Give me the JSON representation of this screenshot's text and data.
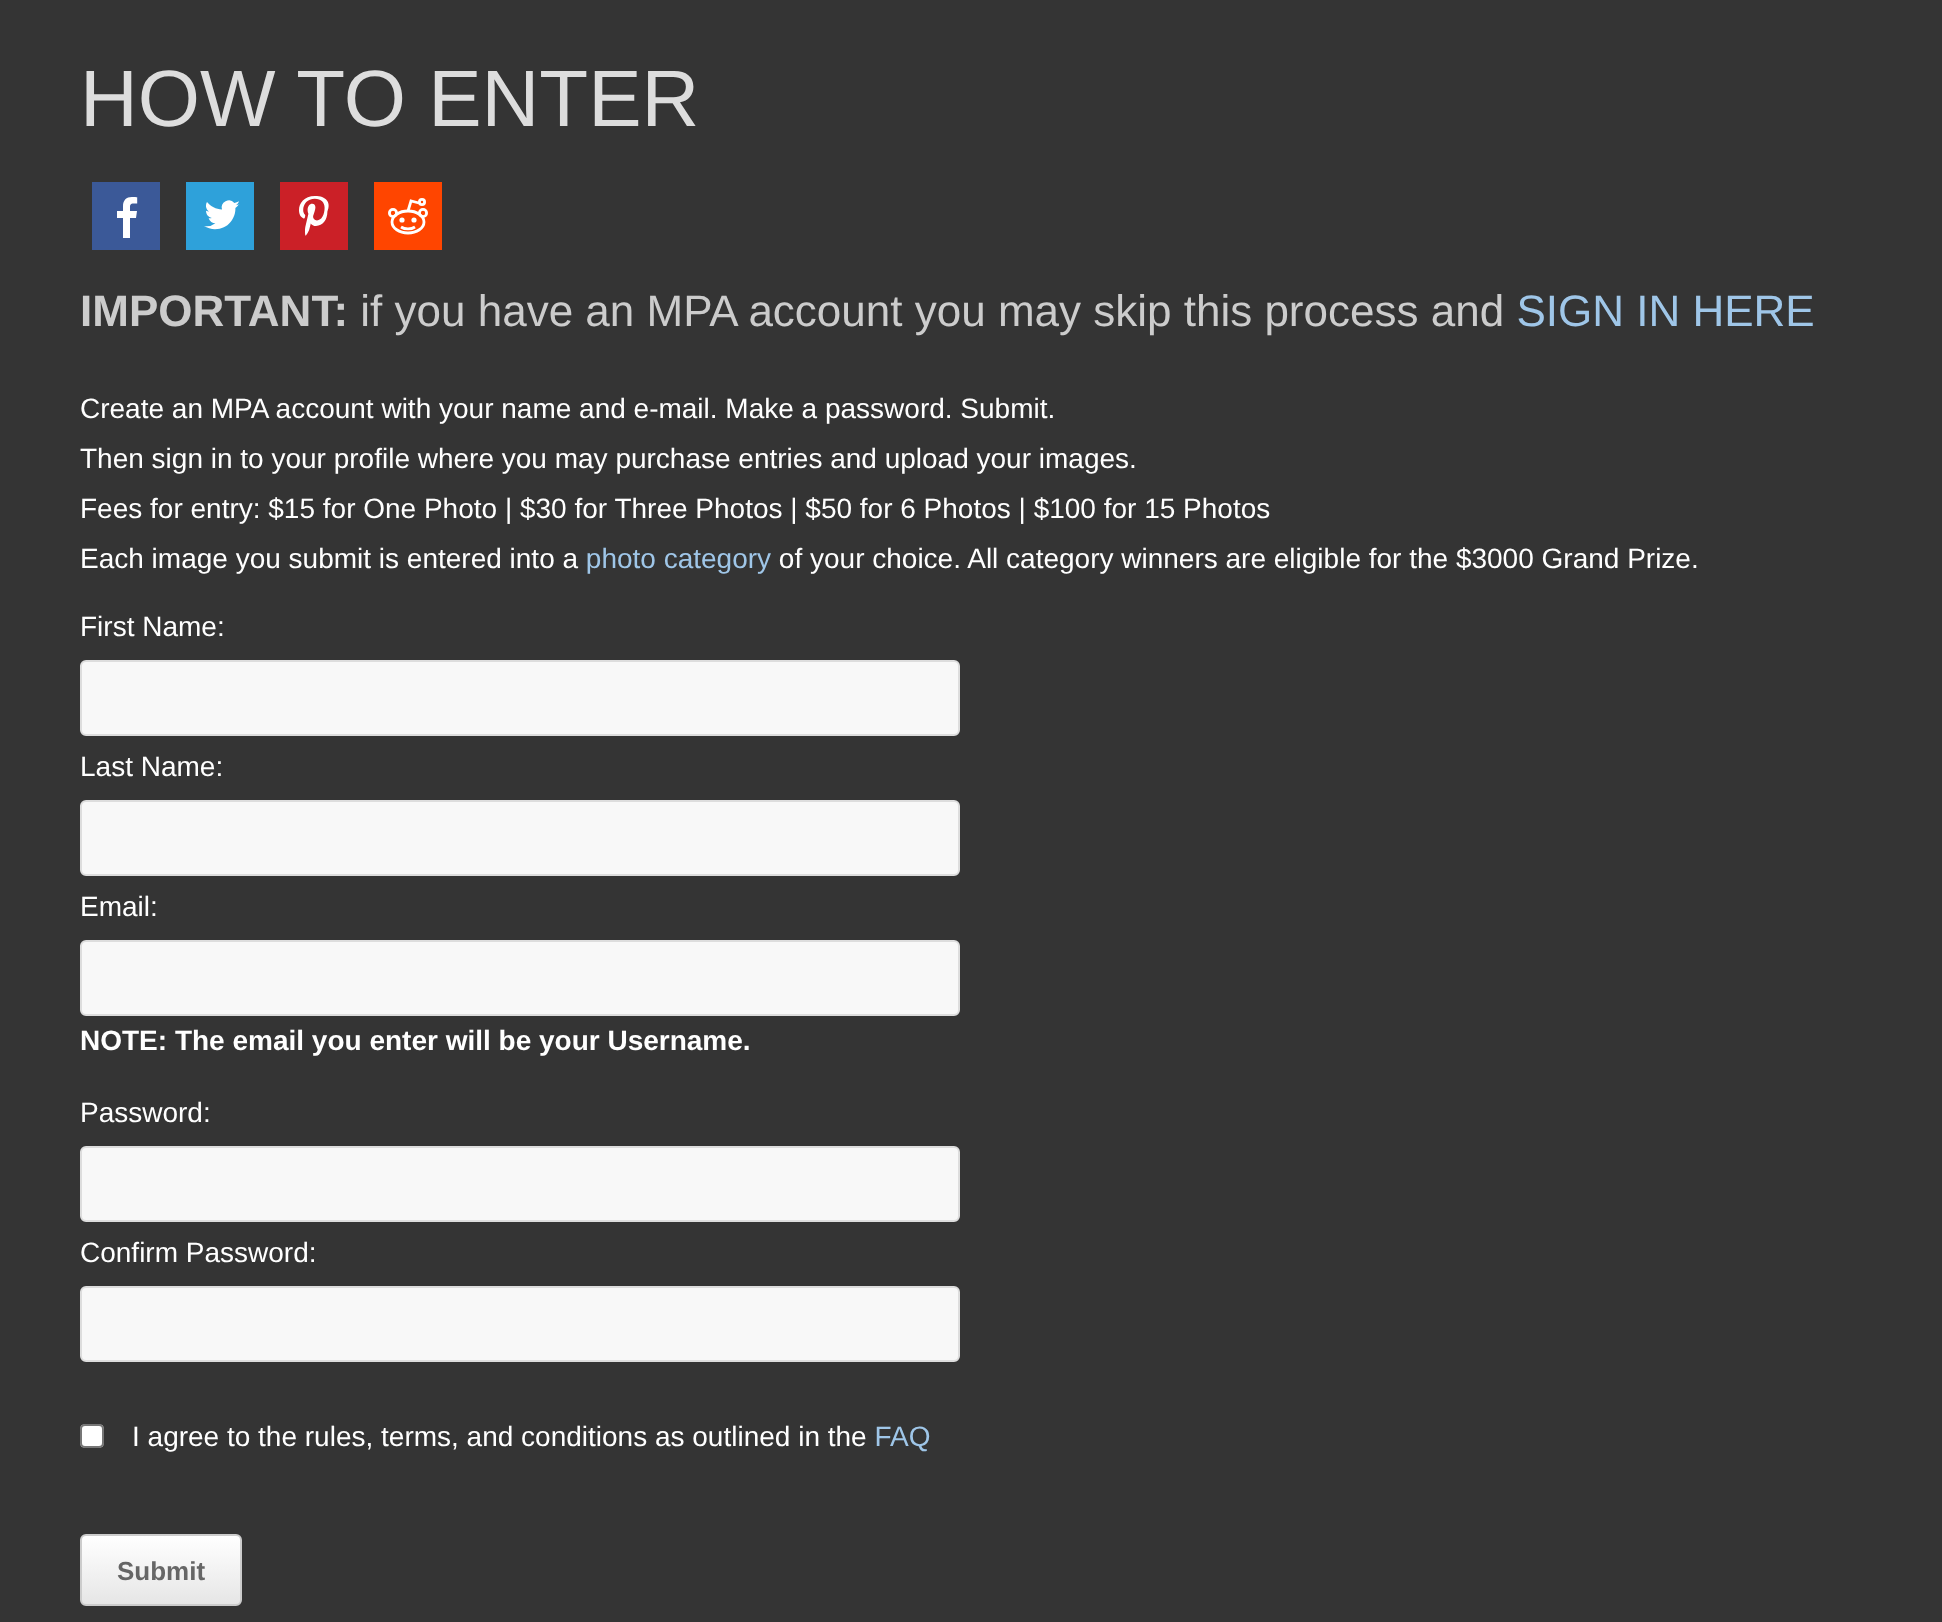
{
  "title": "HOW TO ENTER",
  "share_icons": [
    {
      "kind": "facebook",
      "color": "#3b5998"
    },
    {
      "kind": "twitter",
      "color": "#2ea1da"
    },
    {
      "kind": "pinterest",
      "color": "#cb2027"
    },
    {
      "kind": "reddit",
      "color": "#ff4500"
    }
  ],
  "important": {
    "label": "IMPORTANT:",
    "text": "if you have an MPA account you may skip this process and",
    "link": "SIGN IN HERE"
  },
  "instructions": [
    {
      "text": "Create an MPA account with your name and e-mail. Make a password. Submit."
    },
    {
      "text": "Then sign in to your profile where you may purchase entries and upload your images."
    },
    {
      "text": "Fees for entry: $15 for One Photo | $30 for Three Photos | $50 for 6 Photos | $100 for 15 Photos"
    },
    {
      "text": "Each image you submit is entered into a",
      "link": "photo category",
      "after": "of your choice. All category winners are eligible for the $3000 Grand Prize."
    }
  ],
  "form": [
    {
      "kind": "field",
      "label": "First Name:"
    },
    {
      "kind": "field",
      "label": "Last Name:"
    },
    {
      "kind": "field",
      "label": "Email:"
    },
    {
      "kind": "note",
      "text": "NOTE: The email you enter will be your Username."
    },
    {
      "kind": "field",
      "label": "Password:"
    },
    {
      "kind": "field",
      "label": "Confirm Password:"
    }
  ],
  "agree": {
    "checked": false,
    "text": "I agree to the rules, terms, and conditions as outlined in the",
    "link": "FAQ"
  },
  "submit": "Submit"
}
